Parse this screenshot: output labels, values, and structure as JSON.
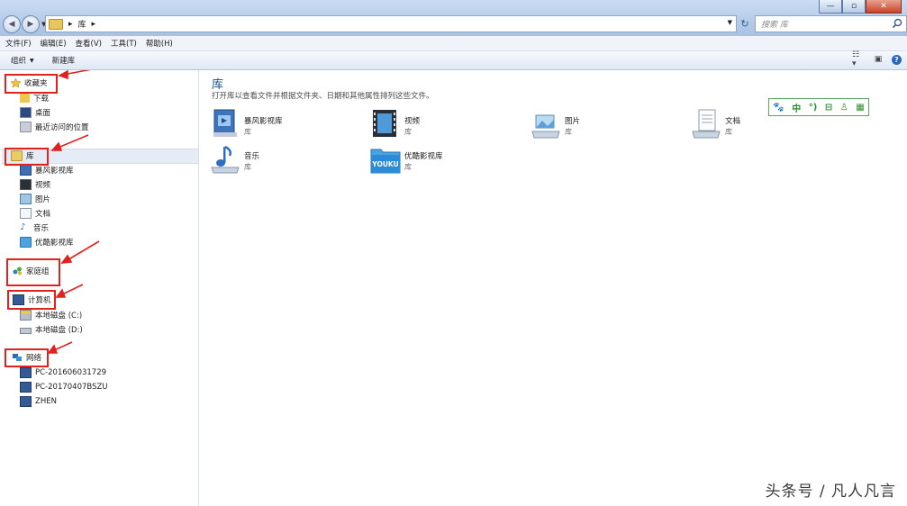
{
  "address": {
    "segments": [
      "▸",
      "库",
      "▸"
    ]
  },
  "search": {
    "placeholder": "搜索 库"
  },
  "window_buttons": {
    "minimize": "—",
    "maximize": "▫",
    "close": "✕"
  },
  "menu": [
    "文件(F)",
    "编辑(E)",
    "查看(V)",
    "工具(T)",
    "帮助(H)"
  ],
  "toolbar": {
    "organize": "组织",
    "new_library": "新建库"
  },
  "nav": {
    "favorites": "收藏夹",
    "favorites_items": [
      "下载",
      "桌面",
      "最近访问的位置"
    ],
    "libraries": "库",
    "library_items": [
      "暴风影视库",
      "视频",
      "图片",
      "文档",
      "音乐",
      "优酷影视库"
    ],
    "homegroup": "家庭组",
    "computer": "计算机",
    "drives": [
      "本地磁盘 (C:)",
      "本地磁盘 (D:)"
    ],
    "network": "网络",
    "network_items": [
      "PC-201606031729",
      "PC-20170407BSZU",
      "ZHEN"
    ]
  },
  "main": {
    "title": "库",
    "description": "打开库以查看文件并根据文件夹、日期和其他属性排列这些文件。",
    "libraries": [
      {
        "name": "暴风影视库",
        "sub": "库",
        "icon": "video-library-icon"
      },
      {
        "name": "视频",
        "sub": "库",
        "icon": "film-icon"
      },
      {
        "name": "图片",
        "sub": "库",
        "icon": "pictures-icon"
      },
      {
        "name": "文档",
        "sub": "库",
        "icon": "documents-icon"
      },
      {
        "name": "音乐",
        "sub": "库",
        "icon": "music-icon"
      },
      {
        "name": "优酷影视库",
        "sub": "库",
        "icon": "youku-folder-icon",
        "badge": "YOUKU"
      }
    ]
  },
  "ime": {
    "label": "中",
    "icons": [
      "paw-icon",
      "dot-icon",
      "bag-icon",
      "person-icon",
      "grid-icon"
    ]
  },
  "watermark": "头条号 / 凡人凡言",
  "colors": {
    "annotation_red": "#e0231f",
    "title_blue": "#1e4c8c",
    "ime_green": "#2a8f2a"
  }
}
